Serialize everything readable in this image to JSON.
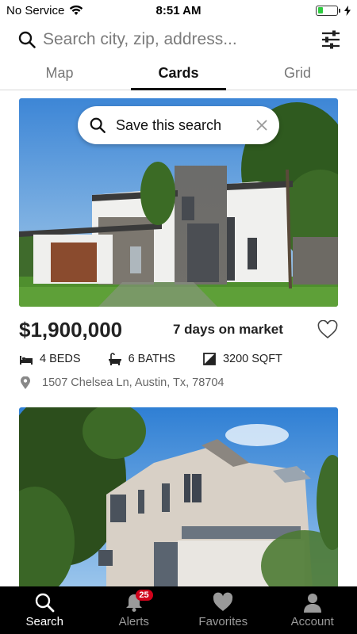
{
  "status_bar": {
    "carrier": "No Service",
    "time": "8:51 AM"
  },
  "search": {
    "placeholder": "Search city, zip, address..."
  },
  "tabs": [
    {
      "label": "Map",
      "active": false
    },
    {
      "label": "Cards",
      "active": true
    },
    {
      "label": "Grid",
      "active": false
    }
  ],
  "save_search": {
    "label": "Save this search"
  },
  "listings": [
    {
      "price": "$1,900,000",
      "days_on_market": "7 days on market",
      "beds": "4 BEDS",
      "baths": "6 BATHS",
      "sqft": "3200 SQFT",
      "address": "1507 Chelsea Ln, Austin, Tx, 78704"
    }
  ],
  "bottom_nav": {
    "items": [
      {
        "label": "Search",
        "icon": "search-icon",
        "active": true
      },
      {
        "label": "Alerts",
        "icon": "bell-icon",
        "badge": "25"
      },
      {
        "label": "Favorites",
        "icon": "heart-icon"
      },
      {
        "label": "Account",
        "icon": "person-icon"
      }
    ]
  },
  "colors": {
    "accent": "#111111",
    "badge": "#d0021b",
    "nav_bg": "#000000",
    "battery": "#2ecc40"
  }
}
